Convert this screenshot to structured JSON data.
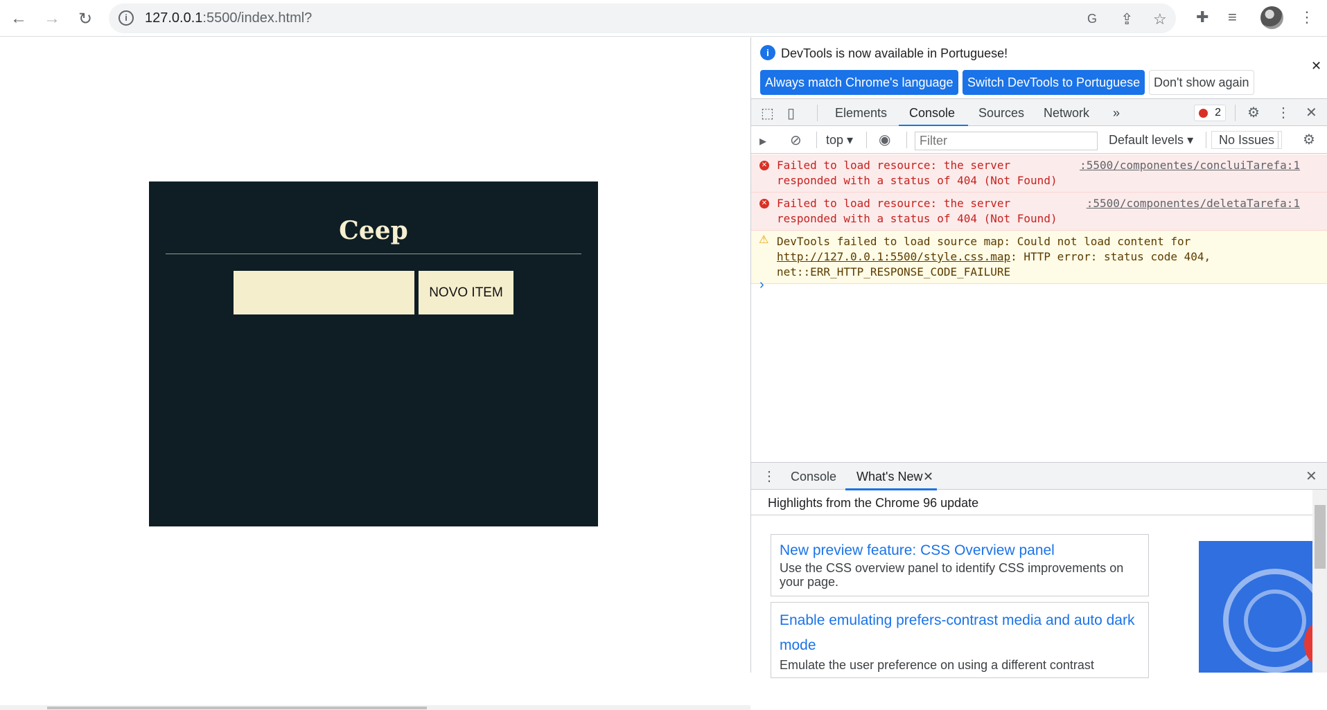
{
  "browser": {
    "url_host": "127.0.0.1",
    "url_rest": ":5500/index.html?"
  },
  "page": {
    "app_title": "Ceep",
    "input_value": "",
    "button_label": "NOVO ITEM"
  },
  "devtools": {
    "banner": {
      "message": "DevTools is now available in Portuguese!",
      "btn_match": "Always match Chrome's language",
      "btn_switch": "Switch DevTools to Portuguese",
      "btn_dont_show": "Don't show again"
    },
    "tabs": [
      "Elements",
      "Console",
      "Sources",
      "Network"
    ],
    "more_tabs": "»",
    "error_count": "2",
    "console_bar": {
      "context": "top",
      "filter_placeholder": "Filter",
      "levels": "Default levels",
      "issues": "No Issues"
    },
    "messages": [
      {
        "type": "error",
        "text": "Failed to load resource: the server responded with a status of 404 (Not Found)",
        "source": ":5500/componentes/concluiTarefa:1"
      },
      {
        "type": "error",
        "text": "Failed to load resource: the server responded with a status of 404 (Not Found)",
        "source": ":5500/componentes/deletaTarefa:1"
      },
      {
        "type": "warning",
        "text_before": "DevTools failed to load source map: Could not load content for ",
        "link": "http://127.0.0.1:5500/style.css.map",
        "text_after": ": HTTP error: status code 404, net::ERR_HTTP_RESPONSE_CODE_FAILURE"
      }
    ],
    "drawer": {
      "tabs": [
        "Console",
        "What's New"
      ],
      "highlights": "Highlights from the Chrome 96 update",
      "cards": [
        {
          "title": "New preview feature: CSS Overview panel",
          "desc": "Use the CSS overview panel to identify CSS improvements on your page."
        },
        {
          "title": "Enable emulating prefers-contrast media and auto dark mode",
          "desc": "Emulate the user preference on using a different contrast"
        }
      ]
    }
  }
}
